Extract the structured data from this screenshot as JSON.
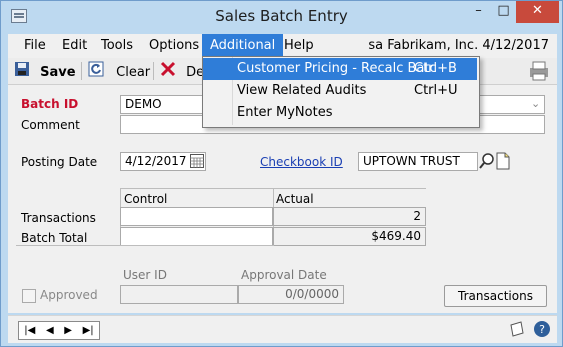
{
  "window": {
    "title": "Sales Batch Entry",
    "controls": [
      "–",
      "□",
      "✕"
    ]
  },
  "menu": {
    "items": [
      "File",
      "Edit",
      "Tools",
      "Options",
      "Additional",
      "Help"
    ],
    "active": "Additional",
    "right_text": "sa  Fabrikam, Inc.  4/12/2017"
  },
  "toolbar": {
    "save": "Save",
    "clear": "Clear",
    "delete": "De"
  },
  "dropdown": {
    "items": [
      {
        "label": "Customer Pricing - Recalc Batc",
        "shortcut": "Ctrl+B"
      },
      {
        "label": "View Related Audits",
        "shortcut": "Ctrl+U"
      },
      {
        "label": "Enter MyNotes",
        "shortcut": ""
      }
    ]
  },
  "form": {
    "batch_id_label": "Batch ID",
    "batch_id_value": "DEMO",
    "comment_label": "Comment",
    "posting_date_label": "Posting Date",
    "posting_date_value": "4/12/2017",
    "checkbook_label": "Checkbook ID",
    "checkbook_value": "UPTOWN TRUST",
    "control_header": "Control",
    "actual_header": "Actual",
    "transactions_label": "Transactions",
    "transactions_actual": "2",
    "batch_total_label": "Batch Total",
    "batch_total_actual": "$469.40",
    "user_id_label": "User ID",
    "approval_date_label": "Approval Date",
    "approval_date_value": "0/0/0000",
    "approved_label": "Approved",
    "transactions_button": "Transactions"
  },
  "status": {
    "nav": [
      "|◀",
      "◀",
      "▶",
      "▶|"
    ]
  }
}
